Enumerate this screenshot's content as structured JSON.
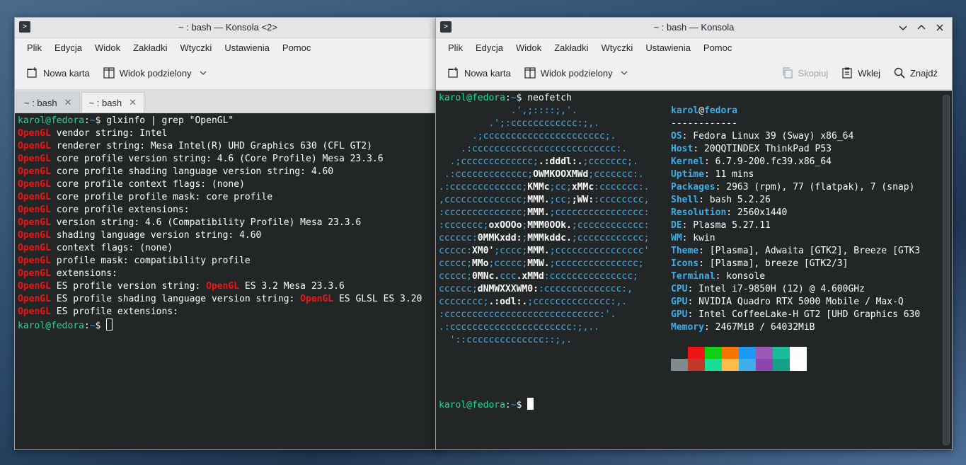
{
  "left_window": {
    "title": "~ : bash — Konsola <2>",
    "menu": [
      "Plik",
      "Edycja",
      "Widok",
      "Zakładki",
      "Wtyczki",
      "Ustawienia",
      "Pomoc"
    ],
    "toolbar": {
      "new_tab": "Nowa karta",
      "split_view": "Widok podzielony"
    },
    "tabs": [
      {
        "label": "~ : bash",
        "close": "✕"
      },
      {
        "label": "~ : bash",
        "close": "✕"
      }
    ],
    "prompt": {
      "user": "karol@fedora",
      "sep": ":",
      "path": "~",
      "sym": "$ "
    },
    "command": "glxinfo | grep \"OpenGL\"",
    "kw": "OpenGL",
    "lines": [
      [
        " vendor string: Intel"
      ],
      [
        " renderer string: Mesa Intel(R) UHD Graphics 630 (CFL GT2)"
      ],
      [
        " core profile version string: 4.6 (Core Profile) Mesa 23.3.6"
      ],
      [
        " core profile shading language version string: 4.60"
      ],
      [
        " core profile context flags: (none)"
      ],
      [
        " core profile profile mask: core profile"
      ],
      [
        " core profile extensions:"
      ],
      [
        " version string: 4.6 (Compatibility Profile) Mesa 23.3.6"
      ],
      [
        " shading language version string: 4.60"
      ],
      [
        " context flags: (none)"
      ],
      [
        " profile mask: compatibility profile"
      ],
      [
        " extensions:"
      ],
      [
        " ES profile version string: ",
        " ES 3.2 Mesa 23.3.6"
      ],
      [
        " ES profile shading language version string: ",
        " ES GLSL ES 3.20"
      ],
      [
        " ES profile extensions:"
      ]
    ]
  },
  "right_window": {
    "title": "~ : bash — Konsola",
    "menu": [
      "Plik",
      "Edycja",
      "Widok",
      "Zakładki",
      "Wtyczki",
      "Ustawienia",
      "Pomoc"
    ],
    "toolbar": {
      "new_tab": "Nowa karta",
      "split_view": "Widok podzielony",
      "copy": "Skopiuj",
      "paste": "Wklej",
      "find": "Znajdź"
    },
    "prompt": {
      "user": "karol@fedora",
      "sep": ":",
      "path": "~",
      "sym": "$ "
    },
    "command": "neofetch",
    "ascii": [
      [
        [
          "a",
          "             .',;::::;,'."
        ]
      ],
      [
        [
          "a",
          "         .';:cccccccccccc:;,."
        ]
      ],
      [
        [
          "a",
          "      .;cccccccccccccccccccccc;."
        ]
      ],
      [
        [
          "a",
          "    .:cccccccccccccccccccccccccc:."
        ]
      ],
      [
        [
          "a",
          "  .;ccccccccccccc;"
        ],
        [
          "w",
          ".:dddl:."
        ],
        [
          "a",
          ";ccccccc;."
        ]
      ],
      [
        [
          "a",
          " .:ccccccccccccc;"
        ],
        [
          "w",
          "OWMKOOXMWd"
        ],
        [
          "a",
          ";ccccccc:."
        ]
      ],
      [
        [
          "a",
          ".:ccccccccccccc;"
        ],
        [
          "w",
          "KMMc"
        ],
        [
          "a",
          ";cc;"
        ],
        [
          "w",
          "xMMc"
        ],
        [
          "a",
          ":ccccccc:."
        ]
      ],
      [
        [
          "a",
          ",cccccccccccccc;"
        ],
        [
          "w",
          "MMM."
        ],
        [
          "a",
          ";cc;"
        ],
        [
          "w",
          ";WW:"
        ],
        [
          "a",
          ":cccccccc,"
        ]
      ],
      [
        [
          "a",
          ":cccccccccccccc;"
        ],
        [
          "w",
          "MMM."
        ],
        [
          "a",
          ";cccccccccccccccc:"
        ]
      ],
      [
        [
          "a",
          ":ccccccc;"
        ],
        [
          "w",
          "oxOOOo"
        ],
        [
          "a",
          ";"
        ],
        [
          "w",
          "MMM0OOk."
        ],
        [
          "a",
          ";cccccccccccc:"
        ]
      ],
      [
        [
          "a",
          "cccccc:"
        ],
        [
          "w",
          "0MMKxdd:"
        ],
        [
          "a",
          ";"
        ],
        [
          "w",
          "MMMkddc."
        ],
        [
          "a",
          ";cccccccccccc;"
        ]
      ],
      [
        [
          "a",
          "ccccc:"
        ],
        [
          "w",
          "XM0'"
        ],
        [
          "a",
          ";cccc;"
        ],
        [
          "w",
          "MMM."
        ],
        [
          "a",
          ";cccccccccccccccc'"
        ]
      ],
      [
        [
          "a",
          "ccccc;"
        ],
        [
          "w",
          "MMo"
        ],
        [
          "a",
          ";ccccc;"
        ],
        [
          "w",
          "MMW."
        ],
        [
          "a",
          ";ccccccccccccccc;"
        ]
      ],
      [
        [
          "a",
          "ccccc;"
        ],
        [
          "w",
          "0MNc."
        ],
        [
          "a",
          "ccc"
        ],
        [
          "w",
          ".xMMd"
        ],
        [
          "a",
          ":ccccccccccccccc;"
        ]
      ],
      [
        [
          "a",
          "cccccc;"
        ],
        [
          "w",
          "dNMWXXXWM0:"
        ],
        [
          "a",
          ":cccccccccccccc:,"
        ]
      ],
      [
        [
          "a",
          "cccccccc;"
        ],
        [
          "w",
          ".:odl:."
        ],
        [
          "a",
          ";cccccccccccccc:,."
        ]
      ],
      [
        [
          "a",
          ":cccccccccccccccccccccccccccc:'."
        ]
      ],
      [
        [
          "a",
          ".:cccccccccccccccccccccc:;,.."
        ]
      ],
      [
        [
          "a",
          "  '::cccccccccccccc::;,."
        ]
      ]
    ],
    "info_header": {
      "user": "karol",
      "at": "@",
      "host": "fedora"
    },
    "separator": "------------",
    "info": [
      {
        "key": "OS",
        "value": ": Fedora Linux 39 (Sway) x86_64"
      },
      {
        "key": "Host",
        "value": ": 20QQTINDEX ThinkPad P53"
      },
      {
        "key": "Kernel",
        "value": ": 6.7.9-200.fc39.x86_64"
      },
      {
        "key": "Uptime",
        "value": ": 11 mins"
      },
      {
        "key": "Packages",
        "value": ": 2963 (rpm), 77 (flatpak), 7 (snap)"
      },
      {
        "key": "Shell",
        "value": ": bash 5.2.26"
      },
      {
        "key": "Resolution",
        "value": ": 2560x1440"
      },
      {
        "key": "DE",
        "value": ": Plasma 5.27.11"
      },
      {
        "key": "WM",
        "value": ": kwin"
      },
      {
        "key": "Theme",
        "value": ": [Plasma], Adwaita [GTK2], Breeze [GTK3"
      },
      {
        "key": "Icons",
        "value": ": [Plasma], breeze [GTK2/3]"
      },
      {
        "key": "Terminal",
        "value": ": konsole"
      },
      {
        "key": "CPU",
        "value": ": Intel i7-9850H (12) @ 4.600GHz"
      },
      {
        "key": "GPU",
        "value": ": NVIDIA Quadro RTX 5000 Mobile / Max-Q"
      },
      {
        "key": "GPU",
        "value": ": Intel CoffeeLake-H GT2 [UHD Graphics 630"
      },
      {
        "key": "Memory",
        "value": ": 2467MiB / 64032MiB"
      }
    ],
    "palette_top": [
      "#232627",
      "#ed1515",
      "#11d116",
      "#f67400",
      "#1d99f3",
      "#9b59b6",
      "#1abc9c",
      "#fcfcfc"
    ],
    "palette_bottom": [
      "#7f8c8d",
      "#c0392b",
      "#1cdc9a",
      "#fdbc4b",
      "#3daee9",
      "#8e44ad",
      "#16a085",
      "#ffffff"
    ]
  }
}
